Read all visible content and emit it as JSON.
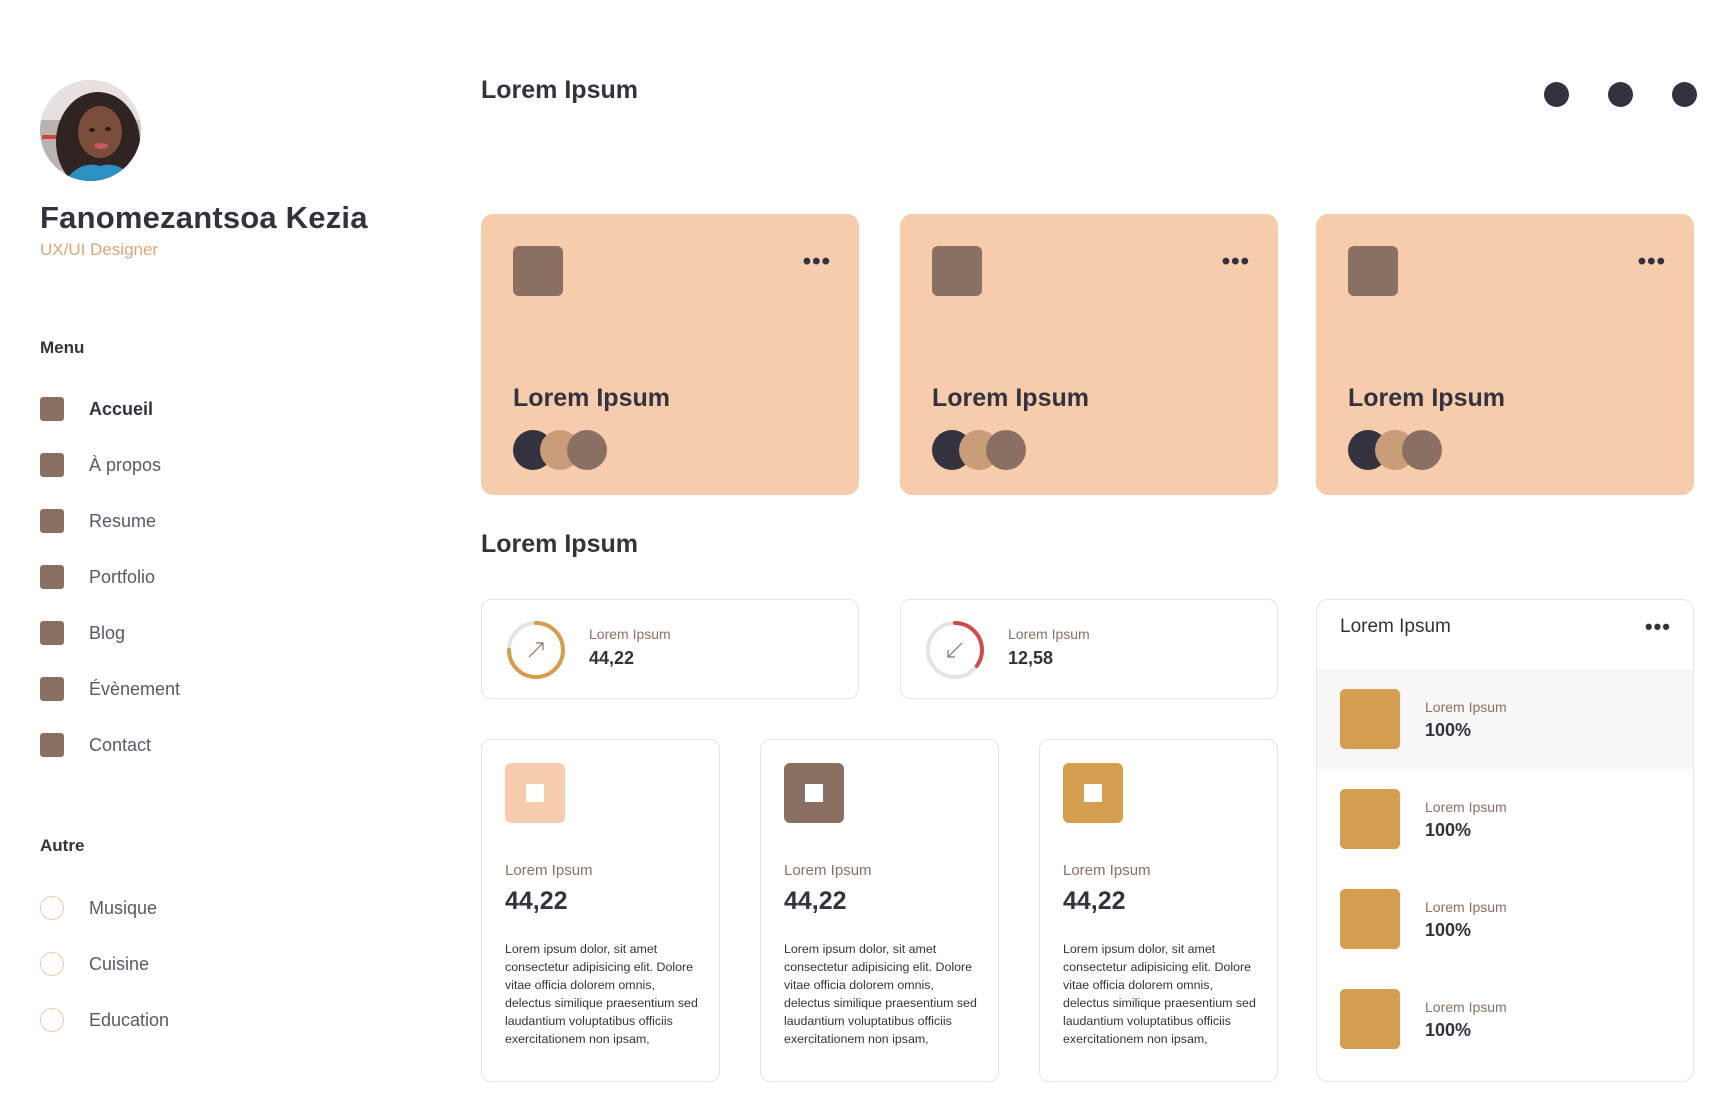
{
  "colors": {
    "dark": "#34323f",
    "brown": "#8a7062",
    "peach": "#f6ccad",
    "tan": "#c99c7a",
    "gold": "#d59d50",
    "role_text": "#d9a777",
    "ring_red": "#d04b4b",
    "ring_gold": "#d59d50"
  },
  "profile": {
    "name": "Fanomezantsoa Kezia",
    "role": "UX/UI Designer",
    "avatar_icon": "profile-photo"
  },
  "menu": {
    "title": "Menu",
    "items": [
      {
        "label": "Accueil",
        "active": true
      },
      {
        "label": "À propos"
      },
      {
        "label": "Resume"
      },
      {
        "label": "Portfolio"
      },
      {
        "label": "Blog"
      },
      {
        "label": "Évènement"
      },
      {
        "label": "Contact"
      }
    ]
  },
  "other": {
    "title": "Autre",
    "items": [
      {
        "label": "Musique"
      },
      {
        "label": "Cuisine"
      },
      {
        "label": "Education"
      }
    ]
  },
  "header": {
    "title": "Lorem Ipsum",
    "dots": 3
  },
  "feature_cards": [
    {
      "title": "Lorem Ipsum",
      "more": "•••"
    },
    {
      "title": "Lorem Ipsum",
      "more": "•••"
    },
    {
      "title": "Lorem Ipsum",
      "more": "•••"
    }
  ],
  "section2": {
    "title": "Lorem Ipsum"
  },
  "stats": [
    {
      "label": "Lorem Ipsum",
      "value": "44,22",
      "icon": "arrow-up-right-icon",
      "progress": 0.75
    },
    {
      "label": "Lorem Ipsum",
      "value": "12,58",
      "icon": "arrow-down-left-icon",
      "progress": 0.35
    }
  ],
  "info_cards": [
    {
      "label": "Lorem Ipsum",
      "value": "44,22",
      "icon_color": "#f6ccad",
      "desc": "Lorem ipsum dolor, sit amet consectetur adipisicing elit. Dolore vitae officia dolorem omnis, delectus similique praesentium sed laudantium voluptatibus officiis exercitationem non ipsam,"
    },
    {
      "label": "Lorem Ipsum",
      "value": "44,22",
      "icon_color": "#8a7062",
      "desc": "Lorem ipsum dolor, sit amet consectetur adipisicing elit. Dolore vitae officia dolorem omnis, delectus similique praesentium sed laudantium voluptatibus officiis exercitationem non ipsam,"
    },
    {
      "label": "Lorem Ipsum",
      "value": "44,22",
      "icon_color": "#d59d50",
      "desc": "Lorem ipsum dolor, sit amet consectetur adipisicing elit. Dolore vitae officia dolorem omnis, delectus similique praesentium sed laudantium voluptatibus officiis exercitationem non ipsam,"
    }
  ],
  "list_panel": {
    "title": "Lorem Ipsum",
    "more": "•••",
    "rows": [
      {
        "label": "Lorem Ipsum",
        "value": "100%",
        "highlight": true
      },
      {
        "label": "Lorem Ipsum",
        "value": "100%"
      },
      {
        "label": "Lorem Ipsum",
        "value": "100%"
      },
      {
        "label": "Lorem Ipsum",
        "value": "100%"
      }
    ]
  }
}
